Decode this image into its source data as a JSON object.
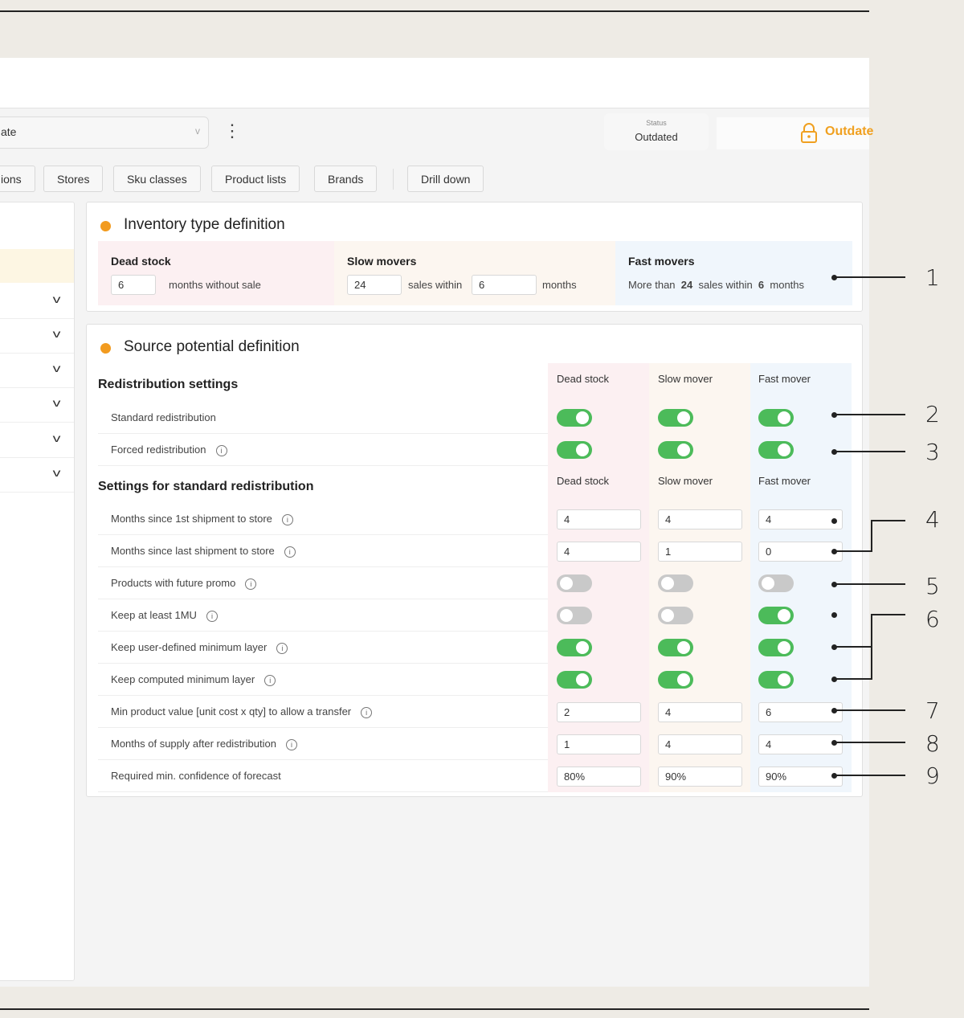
{
  "header": {
    "view_select_value": "ate",
    "status_label": "Status",
    "status_value": "Outdated",
    "lock_label": "Outdate"
  },
  "tabs": [
    "ions",
    "Stores",
    "Sku classes",
    "Product lists",
    "Brands",
    "Drill down"
  ],
  "inventory": {
    "title": "Inventory type definition",
    "dead": {
      "label": "Dead stock",
      "months": "6",
      "text": "months without sale"
    },
    "slow": {
      "label": "Slow movers",
      "sales": "24",
      "text1": "sales within",
      "months": "6",
      "text2": "months"
    },
    "fast": {
      "label": "Fast movers",
      "t1": "More than",
      "sales": "24",
      "t2": "sales within",
      "months": "6",
      "t3": "months"
    }
  },
  "source": {
    "title": "Source potential definition",
    "redistribution_title": "Redistribution settings",
    "standard_title": "Settings for standard redistribution",
    "columns": [
      "Dead stock",
      "Slow mover",
      "Fast mover"
    ],
    "toggle_rows": [
      {
        "label": "Standard redistribution",
        "info": false,
        "values": [
          true,
          true,
          true
        ]
      },
      {
        "label": "Forced redistribution",
        "info": true,
        "values": [
          true,
          true,
          true
        ]
      }
    ],
    "rows": [
      {
        "label": "Months since 1st shipment to store",
        "info": true,
        "type": "input",
        "values": [
          "4",
          "4",
          "4"
        ]
      },
      {
        "label": "Months since last shipment to store",
        "info": true,
        "type": "input",
        "values": [
          "4",
          "1",
          "0"
        ]
      },
      {
        "label": "Products with future promo",
        "info": true,
        "type": "toggle",
        "values": [
          false,
          false,
          false
        ]
      },
      {
        "label": "Keep at least 1MU",
        "info": true,
        "type": "toggle",
        "values": [
          false,
          false,
          true
        ]
      },
      {
        "label": "Keep user-defined minimum layer",
        "info": true,
        "type": "toggle",
        "values": [
          true,
          true,
          true
        ]
      },
      {
        "label": "Keep computed minimum layer",
        "info": true,
        "type": "toggle",
        "values": [
          true,
          true,
          true
        ]
      },
      {
        "label": "Min product value [unit cost x qty] to allow a transfer",
        "info": true,
        "type": "input",
        "values": [
          "2",
          "4",
          "6"
        ]
      },
      {
        "label": "Months of supply after redistribution",
        "info": true,
        "type": "input",
        "values": [
          "1",
          "4",
          "4"
        ]
      },
      {
        "label": "Required min. confidence of forecast",
        "info": false,
        "type": "input",
        "values": [
          "80%",
          "90%",
          "90%"
        ]
      }
    ]
  },
  "annotations": [
    "1",
    "2",
    "3",
    "4",
    "5",
    "6",
    "7",
    "8",
    "9"
  ],
  "colors": {
    "accent": "#f29b1f",
    "toggle_on": "#4cbb5a",
    "dead_bg": "#fcf0f2",
    "slow_bg": "#fcf6f0",
    "fast_bg": "#f0f6fc"
  }
}
